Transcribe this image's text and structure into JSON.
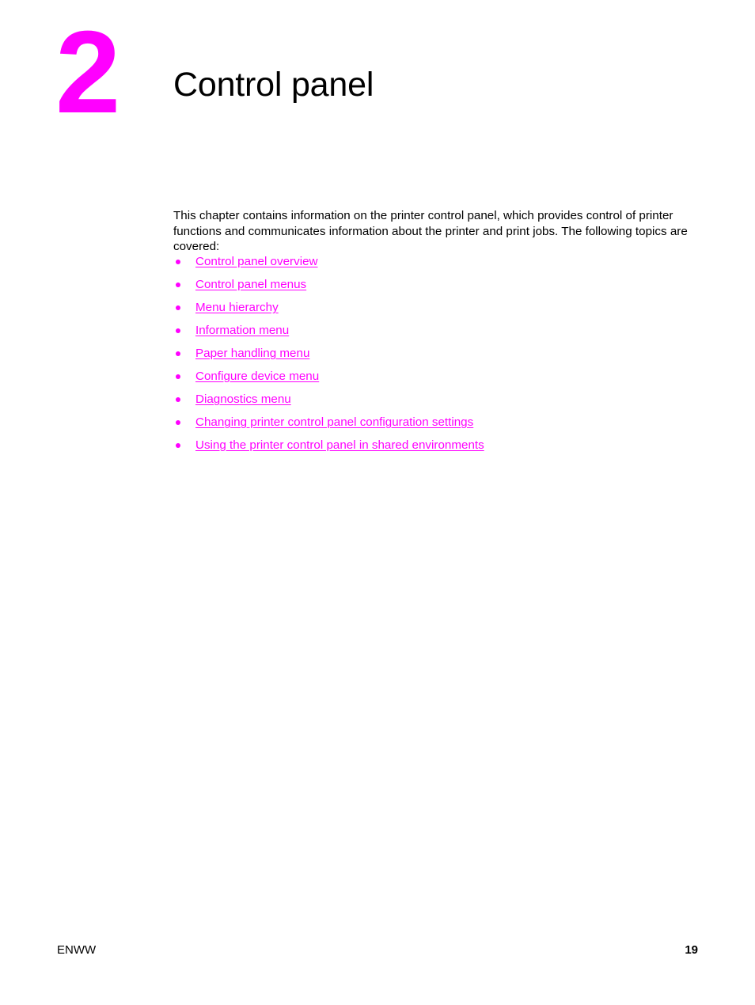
{
  "document": {
    "chapter_number": "2",
    "chapter_title": "Control panel",
    "intro_paragraph": "This chapter contains information on the printer control panel, which provides control of printer functions and communicates information about the printer and print jobs. The following topics are covered:",
    "topics": [
      {
        "label": "Control panel overview"
      },
      {
        "label": "Control panel menus"
      },
      {
        "label": "Menu hierarchy"
      },
      {
        "label": "Information menu"
      },
      {
        "label": "Paper handling menu"
      },
      {
        "label": "Configure device menu"
      },
      {
        "label": "Diagnostics menu"
      },
      {
        "label": "Changing printer control panel configuration settings"
      },
      {
        "label": "Using the printer control panel in shared environments"
      }
    ],
    "footer": {
      "locale": "ENWW",
      "page_number": "19"
    },
    "colors": {
      "accent": "#FF00FF",
      "text": "#000000",
      "background": "#FFFFFF"
    }
  }
}
